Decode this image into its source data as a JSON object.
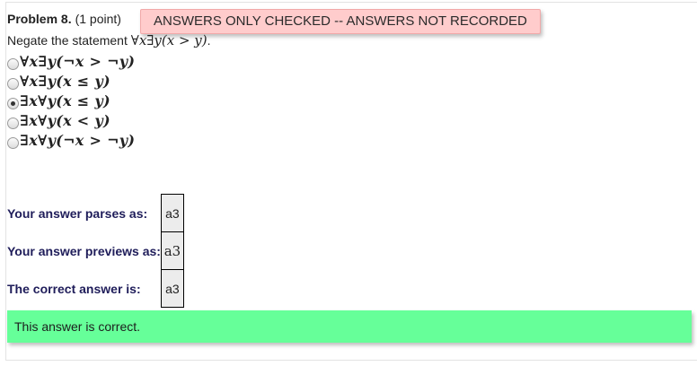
{
  "problem": {
    "number_label": "Problem 8.",
    "points_label": "(1 point)",
    "notice": "ANSWERS ONLY CHECKED -- ANSWERS NOT RECORDED",
    "statement_prefix": "Negate the statement ",
    "statement_math": "∀x∃y(x > y)",
    "statement_suffix": "."
  },
  "choices": [
    {
      "label": "∀x∃y(¬x > ¬y)",
      "checked": false
    },
    {
      "label": "∀x∃y(x ≤ y)",
      "checked": false
    },
    {
      "label": "∃x∀y(x ≤ y)",
      "checked": true
    },
    {
      "label": "∃x∀y(x < y)",
      "checked": false
    },
    {
      "label": "∃x∀y(¬x > ¬y)",
      "checked": false
    }
  ],
  "results": {
    "parses_label": "Your answer parses as:",
    "parses_value": "a3",
    "previews_label": "Your answer previews as:",
    "previews_value": "a3",
    "correct_label": "The correct answer is:",
    "correct_value": "a3"
  },
  "feedback": {
    "message": "This answer is correct.",
    "color": "#66ff99"
  },
  "colors": {
    "notice_bg": "#ffcccc",
    "label_color": "#1f1d5a"
  }
}
